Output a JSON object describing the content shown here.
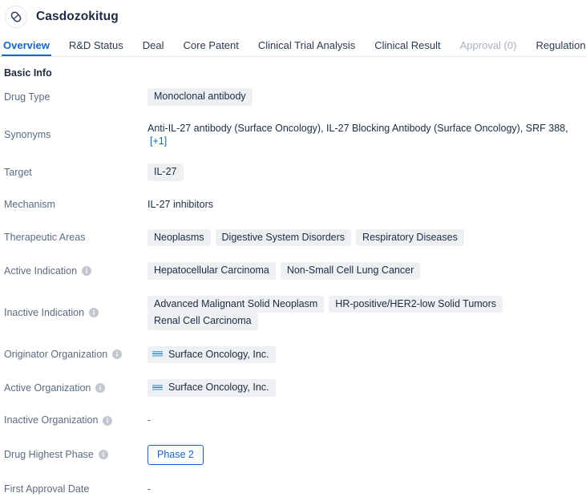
{
  "header": {
    "drug_name": "Casdozokitug",
    "avatar_icon": "pill-capsule-icon"
  },
  "tabs": [
    {
      "label": "Overview",
      "state": "active"
    },
    {
      "label": "R&D Status",
      "state": "normal"
    },
    {
      "label": "Deal",
      "state": "normal"
    },
    {
      "label": "Core Patent",
      "state": "normal"
    },
    {
      "label": "Clinical Trial Analysis",
      "state": "normal"
    },
    {
      "label": "Clinical Result",
      "state": "normal"
    },
    {
      "label": "Approval (0)",
      "state": "disabled"
    },
    {
      "label": "Regulation",
      "state": "normal"
    }
  ],
  "basic_info": {
    "section_title": "Basic Info",
    "drug_type": {
      "label": "Drug Type",
      "tags": [
        "Monoclonal antibody"
      ]
    },
    "synonyms": {
      "label": "Synonyms",
      "text": "Anti-IL-27 antibody (Surface Oncology),  IL-27 Blocking Antibody (Surface Oncology),  SRF 388,",
      "more_link": "[+1]"
    },
    "target": {
      "label": "Target",
      "tags": [
        "IL-27"
      ]
    },
    "mechanism": {
      "label": "Mechanism",
      "value": "IL-27 inhibitors"
    },
    "therapeutic_areas": {
      "label": "Therapeutic Areas",
      "tags": [
        "Neoplasms",
        "Digestive System Disorders",
        "Respiratory Diseases"
      ]
    },
    "active_indication": {
      "label": "Active Indication",
      "has_info": true,
      "tags": [
        "Hepatocellular Carcinoma",
        "Non-Small Cell Lung Cancer"
      ]
    },
    "inactive_indication": {
      "label": "Inactive Indication",
      "has_info": true,
      "tags": [
        "Advanced Malignant Solid Neoplasm",
        "HR-positive/HER2-low Solid Tumors",
        "Renal Cell Carcinoma"
      ]
    },
    "originator_organization": {
      "label": "Originator Organization",
      "has_info": true,
      "orgs": [
        "Surface Oncology, Inc."
      ]
    },
    "active_organization": {
      "label": "Active Organization",
      "has_info": true,
      "orgs": [
        "Surface Oncology, Inc."
      ]
    },
    "inactive_organization": {
      "label": "Inactive Organization",
      "has_info": true,
      "value": "-"
    },
    "drug_highest_phase": {
      "label": "Drug Highest Phase",
      "has_info": true,
      "badge": "Phase 2"
    },
    "first_approval_date": {
      "label": "First Approval Date",
      "has_info": false,
      "value": "-"
    }
  },
  "colors": {
    "accent": "#1266c9",
    "label_text": "#5b6b81",
    "value_text": "#1c2b42",
    "tag_bg": "#eef0f3",
    "disabled_tab": "#a9b2bf",
    "border": "#e6e9ed"
  }
}
